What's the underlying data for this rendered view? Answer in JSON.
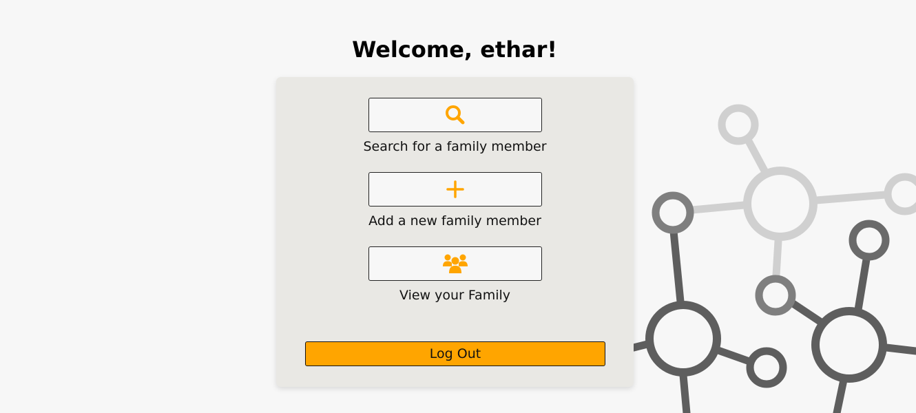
{
  "header": {
    "welcome_title": "Welcome, ethar!"
  },
  "actions": [
    {
      "icon": "search-icon",
      "label": "Search for a family member"
    },
    {
      "icon": "plus-icon",
      "label": "Add a new family member"
    },
    {
      "icon": "users-icon",
      "label": "View your Family"
    }
  ],
  "logout": {
    "label": "Log Out"
  },
  "colors": {
    "accent": "#ffa500",
    "panel_bg": "#e9e8e4",
    "page_bg": "#f7f7f7",
    "network_light": "#d0d0d0",
    "network_mid": "#8a8a8a",
    "network_dark": "#5e5e5e"
  },
  "decoration": {
    "icon": "molecule-network-graphic"
  }
}
